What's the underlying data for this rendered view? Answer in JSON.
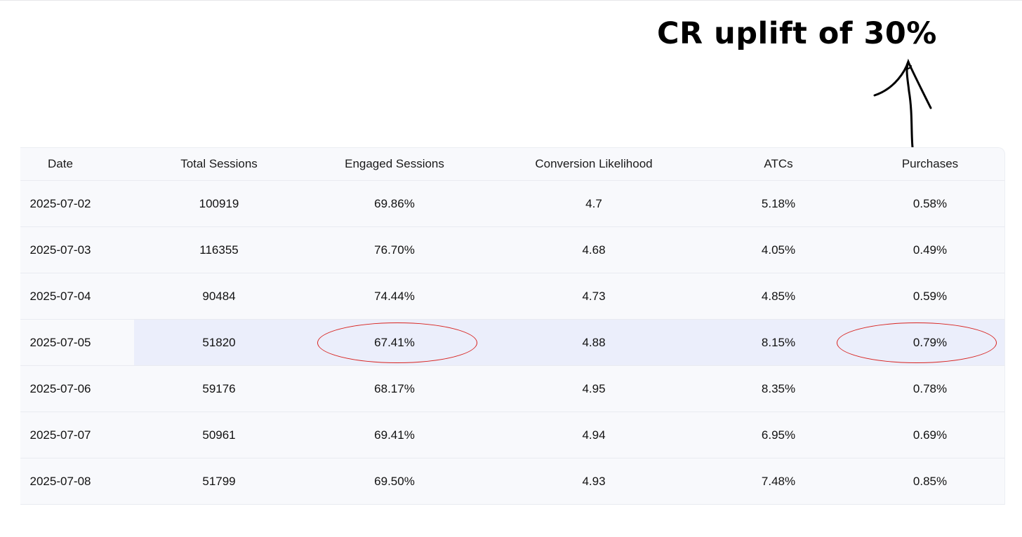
{
  "annotation": {
    "text": "CR uplift of 30%",
    "arrow_icon": "hand-drawn-arrow-up-icon"
  },
  "table": {
    "columns": [
      "Date",
      "Total Sessions",
      "Engaged Sessions",
      "Conversion Likelihood",
      "ATCs",
      "Purchases"
    ],
    "rows": [
      [
        "2025-07-02",
        "100919",
        "69.86%",
        "4.7",
        "5.18%",
        "0.58%"
      ],
      [
        "2025-07-03",
        "116355",
        "76.70%",
        "4.68",
        "4.05%",
        "0.49%"
      ],
      [
        "2025-07-04",
        "90484",
        "74.44%",
        "4.73",
        "4.85%",
        "0.59%"
      ],
      [
        "2025-07-05",
        "51820",
        "67.41%",
        "4.88",
        "8.15%",
        "0.79%"
      ],
      [
        "2025-07-06",
        "59176",
        "68.17%",
        "4.95",
        "8.35%",
        "0.78%"
      ],
      [
        "2025-07-07",
        "50961",
        "69.41%",
        "4.94",
        "6.95%",
        "0.69%"
      ],
      [
        "2025-07-08",
        "51799",
        "69.50%",
        "4.93",
        "7.48%",
        "0.85%"
      ]
    ],
    "highlighted_row": 3,
    "circled_cells": [
      [
        3,
        2
      ],
      [
        3,
        5
      ]
    ]
  },
  "colors": {
    "highlight_row": "#ebeefb",
    "circle_stroke": "#d8231f",
    "table_bg": "#f8f9fc"
  }
}
